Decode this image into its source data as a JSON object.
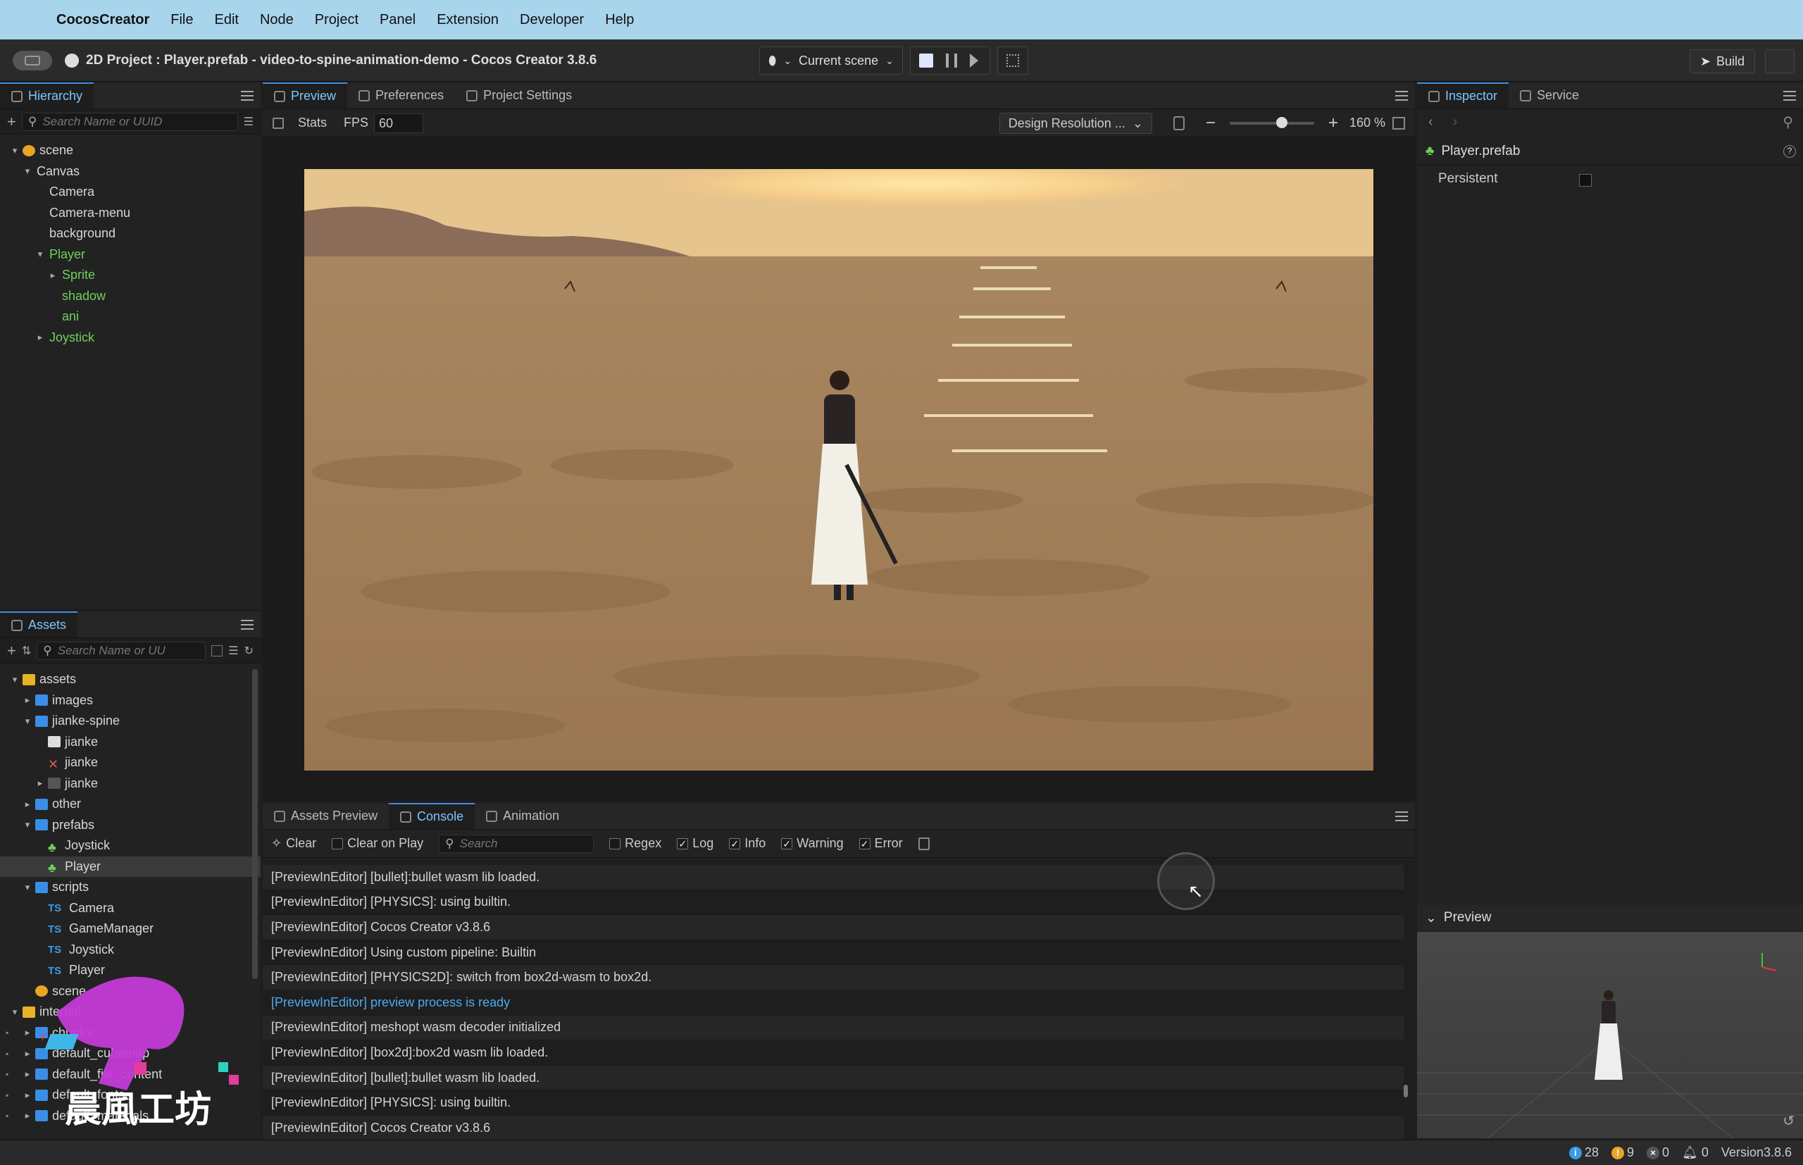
{
  "menubar": {
    "app": "CocosCreator",
    "items": [
      "File",
      "Edit",
      "Node",
      "Project",
      "Panel",
      "Extension",
      "Developer",
      "Help"
    ]
  },
  "titlebar": {
    "title": "2D Project : Player.prefab - video-to-spine-animation-demo - Cocos Creator 3.8.6",
    "scene_select": "Current scene",
    "build_label": "Build"
  },
  "hierarchy": {
    "tab": "Hierarchy",
    "search_placeholder": "Search Name or UUID",
    "nodes": [
      {
        "label": "scene",
        "depth": 0,
        "caret": "v",
        "icon": "scene-icon"
      },
      {
        "label": "Canvas",
        "depth": 1,
        "caret": "v"
      },
      {
        "label": "Camera",
        "depth": 2,
        "caret": ""
      },
      {
        "label": "Camera-menu",
        "depth": 2,
        "caret": ""
      },
      {
        "label": "background",
        "depth": 2,
        "caret": ""
      },
      {
        "label": "Player",
        "depth": 2,
        "caret": "v",
        "prefab": true
      },
      {
        "label": "Sprite",
        "depth": 3,
        "caret": ">",
        "prefab": true
      },
      {
        "label": "shadow",
        "depth": 3,
        "caret": "",
        "prefab": true
      },
      {
        "label": "ani",
        "depth": 3,
        "caret": "",
        "prefab": true
      },
      {
        "label": "Joystick",
        "depth": 2,
        "caret": ">",
        "prefab": true
      }
    ]
  },
  "assets": {
    "tab": "Assets",
    "search_placeholder": "Search Name or UU",
    "nodes": [
      {
        "label": "assets",
        "depth": 0,
        "caret": "v",
        "icon": "db"
      },
      {
        "label": "images",
        "depth": 1,
        "caret": ">",
        "icon": "folder"
      },
      {
        "label": "jianke-spine",
        "depth": 1,
        "caret": "v",
        "icon": "folder"
      },
      {
        "label": "jianke",
        "depth": 2,
        "caret": "",
        "icon": "file"
      },
      {
        "label": "jianke",
        "depth": 2,
        "caret": "",
        "icon": "spine"
      },
      {
        "label": "jianke",
        "depth": 2,
        "caret": ">",
        "icon": "atlas"
      },
      {
        "label": "other",
        "depth": 1,
        "caret": ">",
        "icon": "folder"
      },
      {
        "label": "prefabs",
        "depth": 1,
        "caret": "v",
        "icon": "folder"
      },
      {
        "label": "Joystick",
        "depth": 2,
        "caret": "",
        "icon": "prefab"
      },
      {
        "label": "Player",
        "depth": 2,
        "caret": "",
        "icon": "prefab",
        "selected": true
      },
      {
        "label": "scripts",
        "depth": 1,
        "caret": "v",
        "icon": "folder"
      },
      {
        "label": "Camera",
        "depth": 2,
        "caret": "",
        "icon": "ts"
      },
      {
        "label": "GameManager",
        "depth": 2,
        "caret": "",
        "icon": "ts"
      },
      {
        "label": "Joystick",
        "depth": 2,
        "caret": "",
        "icon": "ts"
      },
      {
        "label": "Player",
        "depth": 2,
        "caret": "",
        "icon": "ts"
      },
      {
        "label": "scene",
        "depth": 1,
        "caret": "",
        "icon": "scene"
      },
      {
        "label": "internal",
        "depth": 0,
        "caret": "v",
        "icon": "db"
      },
      {
        "label": "chunks",
        "depth": 1,
        "caret": ">",
        "icon": "folder",
        "lock": true
      },
      {
        "label": "default_cubemap",
        "depth": 1,
        "caret": ">",
        "icon": "folder",
        "lock": true
      },
      {
        "label": "default_file_content",
        "depth": 1,
        "caret": ">",
        "icon": "folder",
        "lock": true
      },
      {
        "label": "default_fonts",
        "depth": 1,
        "caret": ">",
        "icon": "folder",
        "lock": true
      },
      {
        "label": "default_materials",
        "depth": 1,
        "caret": ">",
        "icon": "folder",
        "lock": true
      }
    ]
  },
  "preview": {
    "tabs": [
      "Preview",
      "Preferences",
      "Project Settings"
    ],
    "stats_label": "Stats",
    "fps_label": "FPS",
    "fps_value": "60",
    "design_resolution": "Design Resolution ...",
    "zoom": "160 %"
  },
  "inspector": {
    "tabs": [
      "Inspector",
      "Service"
    ],
    "asset_name": "Player.prefab",
    "persistent_label": "Persistent",
    "preview_label": "Preview"
  },
  "console": {
    "tabs": [
      "Assets Preview",
      "Console",
      "Animation"
    ],
    "clear_label": "Clear",
    "clear_on_play_label": "Clear on Play",
    "search_placeholder": "Search",
    "filters": [
      {
        "label": "Regex",
        "checked": false
      },
      {
        "label": "Log",
        "checked": true
      },
      {
        "label": "Info",
        "checked": true
      },
      {
        "label": "Warning",
        "checked": true
      },
      {
        "label": "Error",
        "checked": true
      }
    ],
    "logs": [
      {
        "text": "[PreviewInEditor] [bullet]:bullet wasm lib loaded.",
        "type": "log"
      },
      {
        "text": "[PreviewInEditor] [PHYSICS]: using builtin.",
        "type": "log"
      },
      {
        "text": "[PreviewInEditor] Cocos Creator v3.8.6",
        "type": "log"
      },
      {
        "text": "[PreviewInEditor] Using custom pipeline: Builtin",
        "type": "log"
      },
      {
        "text": "[PreviewInEditor] [PHYSICS2D]: switch from box2d-wasm to box2d.",
        "type": "log"
      },
      {
        "text": "[PreviewInEditor] preview process is ready",
        "type": "info"
      },
      {
        "text": "[PreviewInEditor] meshopt wasm decoder initialized",
        "type": "log"
      },
      {
        "text": "[PreviewInEditor] [box2d]:box2d wasm lib loaded.",
        "type": "log"
      },
      {
        "text": "[PreviewInEditor] [bullet]:bullet wasm lib loaded.",
        "type": "log"
      },
      {
        "text": "[PreviewInEditor] [PHYSICS]: using builtin.",
        "type": "log"
      },
      {
        "text": "[PreviewInEditor] Cocos Creator v3.8.6",
        "type": "log"
      }
    ]
  },
  "statusbar": {
    "info_count": "28",
    "warn_count": "9",
    "error_count": "0",
    "notify_count": "0",
    "version": "Version3.8.6"
  },
  "watermark": {
    "text": "晨風工坊"
  }
}
